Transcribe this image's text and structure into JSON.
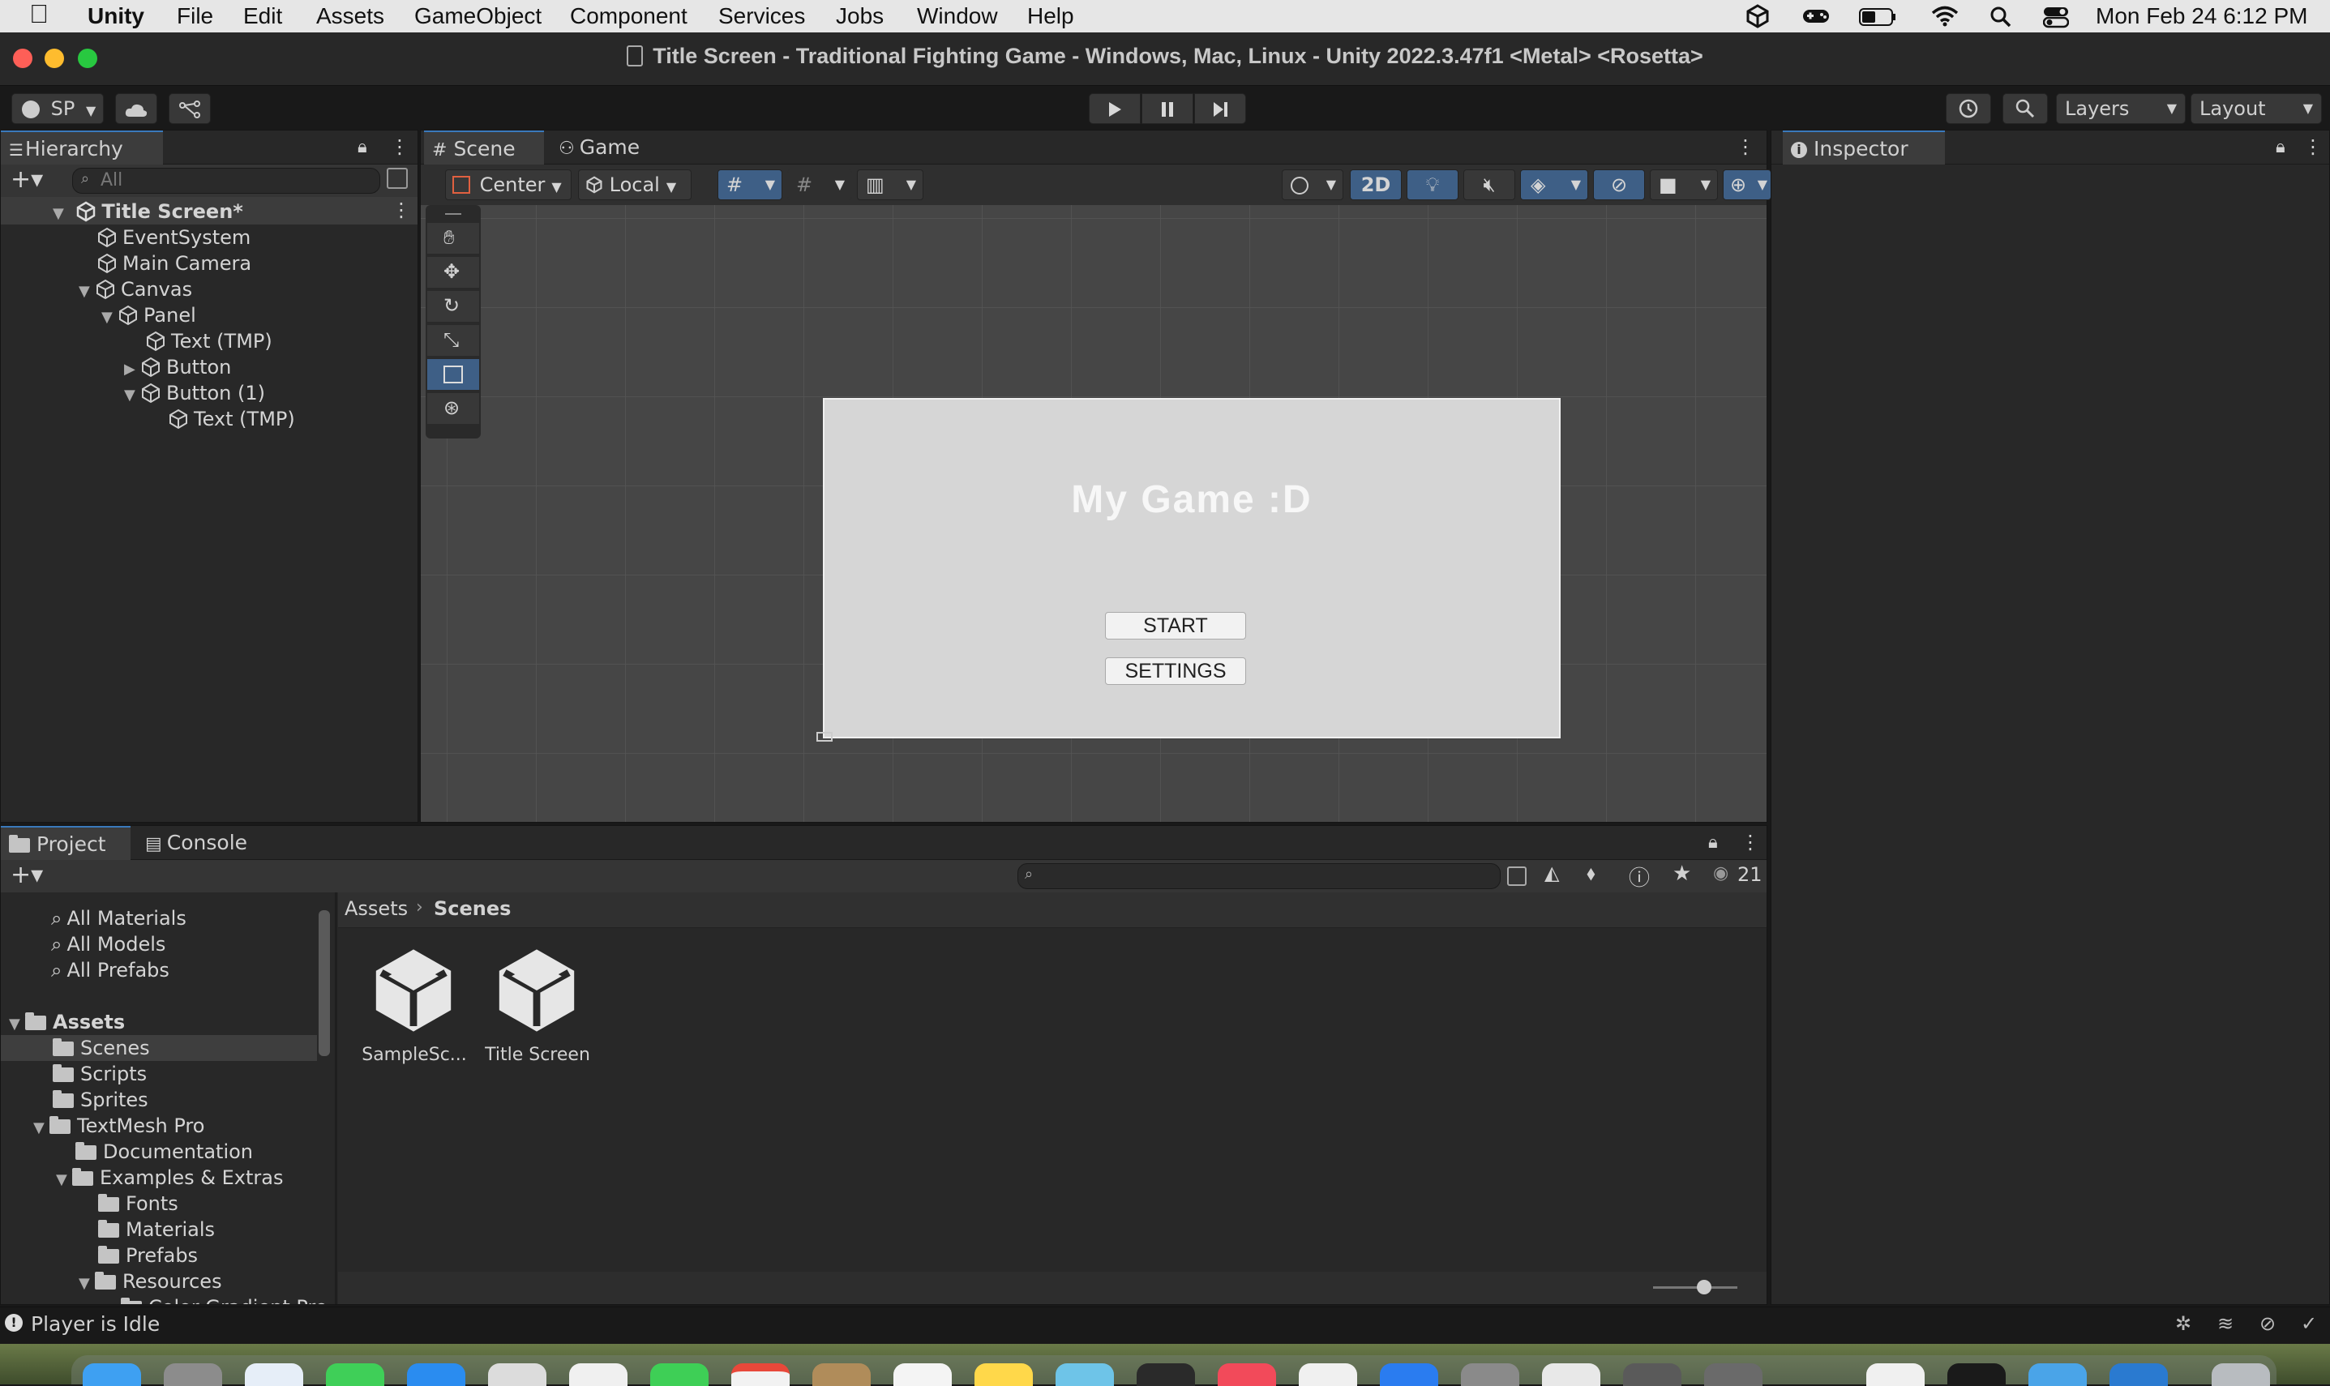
{
  "menubar": {
    "app": "Unity",
    "items": [
      "File",
      "Edit",
      "Assets",
      "GameObject",
      "Component",
      "Services",
      "Jobs",
      "Window",
      "Help"
    ],
    "clock": "Mon Feb 24  6:12 PM"
  },
  "window": {
    "title": "Title Screen - Traditional Fighting Game - Windows, Mac, Linux - Unity 2022.3.47f1 <Metal> <Rosetta>"
  },
  "toolbar": {
    "account": "SP",
    "layers": "Layers",
    "layout": "Layout"
  },
  "hierarchy": {
    "tab": "Hierarchy",
    "search_placeholder": "All",
    "scene": "Title Screen*",
    "items": [
      "EventSystem",
      "Main Camera",
      "Canvas",
      "Panel",
      "Text (TMP)",
      "Button",
      "Button (1)",
      "Text (TMP)"
    ]
  },
  "scene_view": {
    "tabs": [
      "Scene",
      "Game"
    ],
    "pivot": "Center",
    "space": "Local",
    "mode_2d": "2D",
    "canvas": {
      "title": "My Game :D",
      "buttons": [
        "START",
        "SETTINGS"
      ]
    }
  },
  "inspector": {
    "tab": "Inspector"
  },
  "project": {
    "tabs": [
      "Project",
      "Console"
    ],
    "hidden_count": "21",
    "favorites": [
      "All Materials",
      "All Models",
      "All Prefabs"
    ],
    "tree": [
      {
        "label": "Assets",
        "bold": true
      },
      {
        "label": "Scenes"
      },
      {
        "label": "Scripts"
      },
      {
        "label": "Sprites"
      },
      {
        "label": "TextMesh Pro"
      },
      {
        "label": "Documentation"
      },
      {
        "label": "Examples & Extras"
      },
      {
        "label": "Fonts"
      },
      {
        "label": "Materials"
      },
      {
        "label": "Prefabs"
      },
      {
        "label": "Resources"
      },
      {
        "label": "Color Gradient Pre"
      }
    ],
    "breadcrumb": [
      "Assets",
      "Scenes"
    ],
    "assets": [
      "SampleSc...",
      "Title Screen"
    ]
  },
  "status": {
    "text": "Player is Idle"
  },
  "colors": {
    "accent": "#3e5f86",
    "panel": "#282828",
    "scene_bg": "#464646",
    "canvas": "#d6d6d6"
  }
}
